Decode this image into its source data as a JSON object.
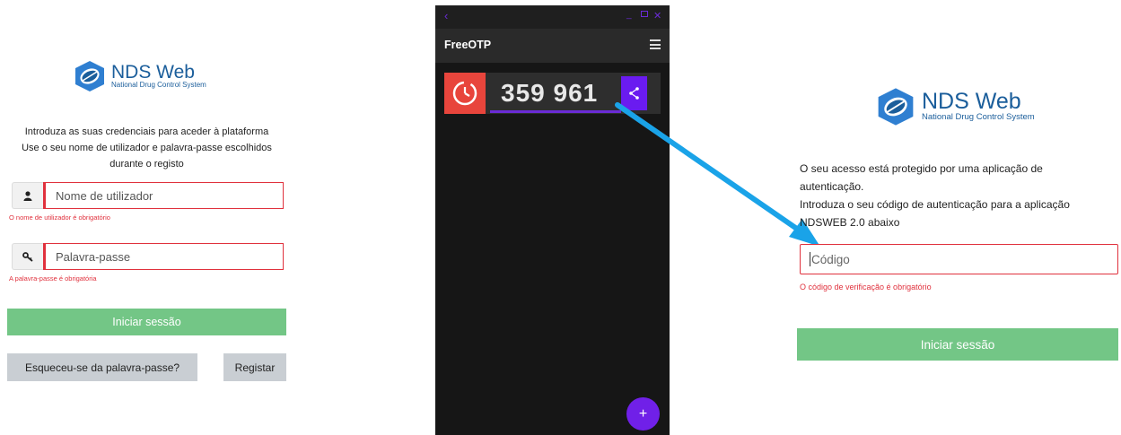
{
  "left_login": {
    "logo": {
      "title": "NDS Web",
      "subtitle": "National Drug Control System"
    },
    "intro": [
      "Introduza as suas credenciais para aceder à plataforma",
      "Use o seu nome de utilizador e palavra-passe escolhidos",
      "durante o registo"
    ],
    "username": {
      "placeholder": "Nome de utilizador",
      "icon": "user-icon",
      "error": "O nome de utilizador é obrigatório"
    },
    "password": {
      "placeholder": "Palavra-passe",
      "icon": "key-icon",
      "error": "A palavra-passe é obrigatória"
    },
    "login_button": "Iniciar sessão",
    "forgot_button": "Esqueceu-se da palavra-passe?",
    "register_button": "Registar"
  },
  "freeotp": {
    "app_title": "FreeOTP",
    "token_code": "359 961",
    "token_progress": 0.65,
    "add_button": "+",
    "colors": {
      "accent": "#6a1bf0",
      "token_red": "#e8453c",
      "background": "#161616"
    }
  },
  "right_2fa": {
    "logo": {
      "title": "NDS Web",
      "subtitle": "National Drug Control System"
    },
    "message": [
      "O seu acesso está protegido por uma aplicação de",
      "autenticação.",
      "Introduza o seu código de autenticação para a aplicação",
      "NDSWEB 2.0 abaixo"
    ],
    "code_placeholder": "Código",
    "code_error": "O código de verificação é obrigatório",
    "login_button": "Iniciar sessão"
  },
  "annotation": {
    "arrow_color": "#1aa3e8"
  }
}
